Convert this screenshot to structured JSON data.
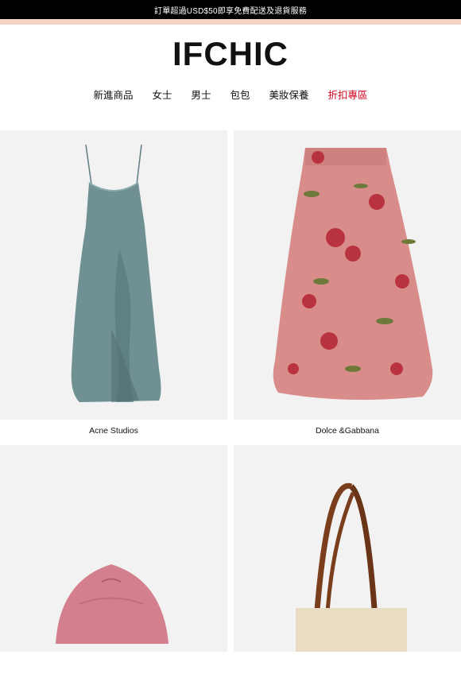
{
  "announcement": {
    "text": "訂單超過USD$50即享免費配送及退貨服務"
  },
  "brand": {
    "logo_text": "IFCHIC"
  },
  "nav": {
    "items": [
      {
        "label": "新進商品"
      },
      {
        "label": "女士"
      },
      {
        "label": "男士"
      },
      {
        "label": "包包"
      },
      {
        "label": "美妝保養"
      },
      {
        "label": "折扣專區",
        "highlight": true
      }
    ],
    "highlight_color": "#d0021b"
  },
  "products": [
    {
      "brand": "Acne Studios",
      "image_icon": "slip-dress-image",
      "color": "#6c8f91"
    },
    {
      "brand": "Dolce &Gabbana",
      "image_icon": "floral-skirt-image",
      "color": "#d98d8a"
    },
    {
      "brand": "",
      "image_icon": "baseball-cap-image",
      "color": "#d47f8d"
    },
    {
      "brand": "",
      "image_icon": "tote-bag-image",
      "color": "#7a3e1c"
    }
  ]
}
